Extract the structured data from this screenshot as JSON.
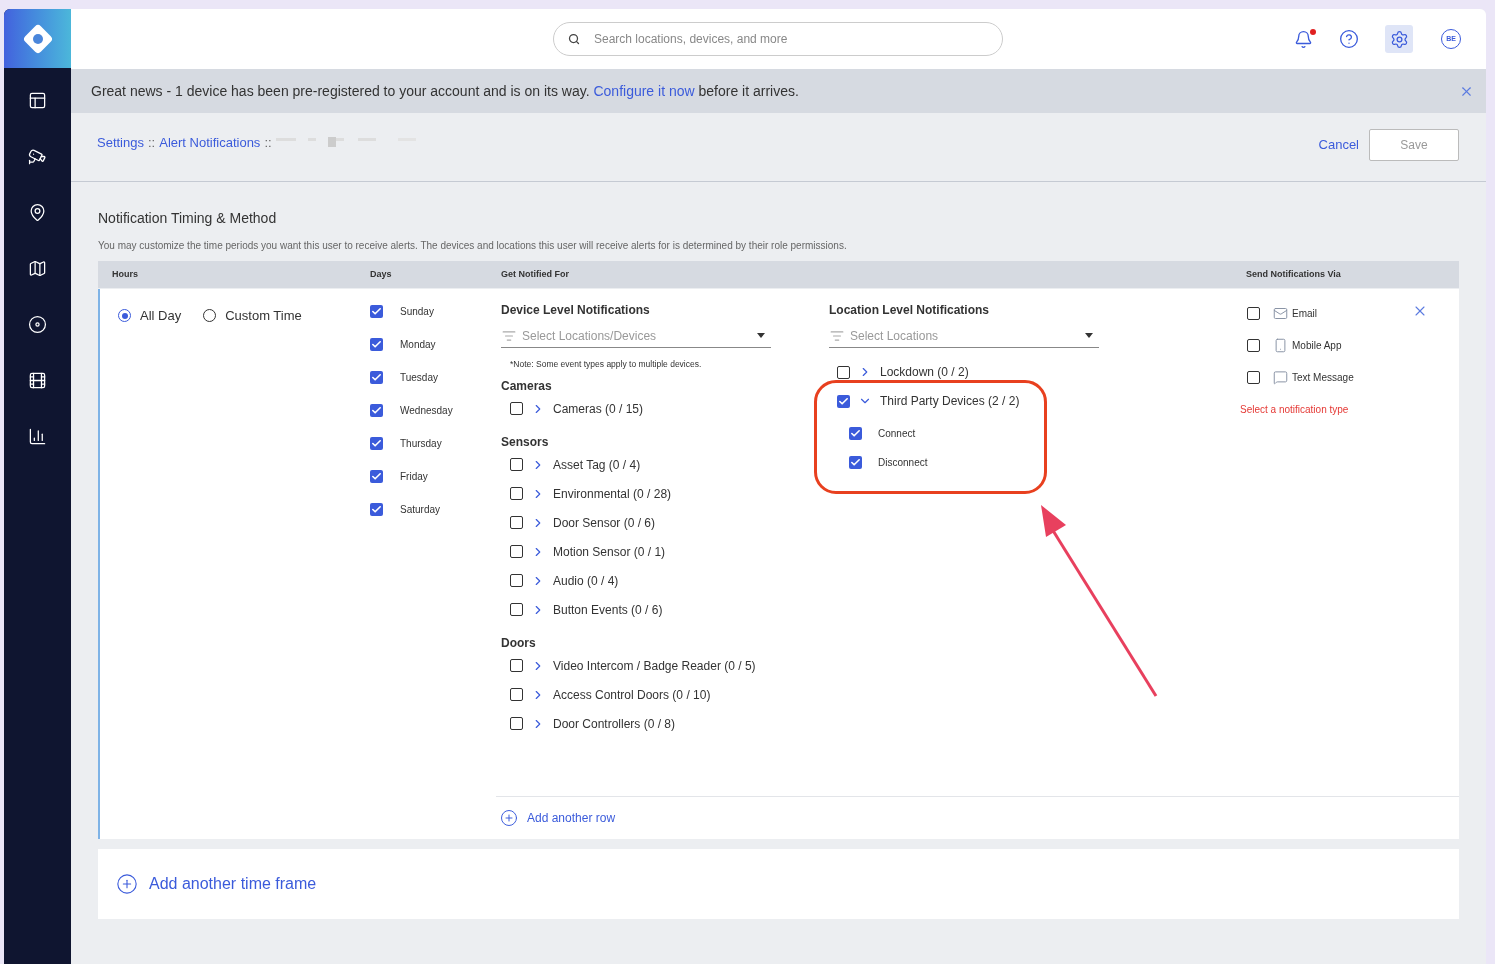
{
  "search": {
    "placeholder": "Search locations, devices, and more"
  },
  "notifications": {
    "unread": true
  },
  "avatar": "BE",
  "banner": {
    "text_before": "Great news - 1 device has been pre-registered to your account and is on its way.",
    "link": "Configure it now",
    "text_after": "before it arrives."
  },
  "breadcrumb": {
    "items": [
      "Settings",
      "Alert Notifications"
    ],
    "separator": "::"
  },
  "actions": {
    "cancel": "Cancel",
    "save": "Save",
    "save_disabled": true
  },
  "section": {
    "title": "Notification Timing & Method",
    "description": "You may customize the time periods you want this user to receive alerts. The devices and locations this user will receive alerts for is determined by their role permissions."
  },
  "columns": [
    "Hours",
    "Days",
    "Get Notified For",
    "Send Notifications Via"
  ],
  "hours": [
    {
      "label": "All Day",
      "selected": true
    },
    {
      "label": "Custom Time",
      "selected": false
    }
  ],
  "days": [
    {
      "label": "Sunday",
      "checked": true
    },
    {
      "label": "Monday",
      "checked": true
    },
    {
      "label": "Tuesday",
      "checked": true
    },
    {
      "label": "Wednesday",
      "checked": true
    },
    {
      "label": "Thursday",
      "checked": true
    },
    {
      "label": "Friday",
      "checked": true
    },
    {
      "label": "Saturday",
      "checked": true
    }
  ],
  "device_level": {
    "title": "Device Level Notifications",
    "placeholder": "Select Locations/Devices",
    "note": "*Note: Some event types apply to multiple devices.",
    "groups": [
      {
        "title": "Cameras",
        "items": [
          {
            "label": "Cameras (0 / 15)",
            "checked": false,
            "expanded": false
          }
        ]
      },
      {
        "title": "Sensors",
        "items": [
          {
            "label": "Asset Tag (0 / 4)",
            "checked": false,
            "expanded": false
          },
          {
            "label": "Environmental (0 / 28)",
            "checked": false,
            "expanded": false
          },
          {
            "label": "Door Sensor (0 / 6)",
            "checked": false,
            "expanded": false
          },
          {
            "label": "Motion Sensor (0 / 1)",
            "checked": false,
            "expanded": false
          },
          {
            "label": "Audio (0 / 4)",
            "checked": false,
            "expanded": false
          },
          {
            "label": "Button Events (0 / 6)",
            "checked": false,
            "expanded": false
          }
        ]
      },
      {
        "title": "Doors",
        "items": [
          {
            "label": "Video Intercom / Badge Reader (0 / 5)",
            "checked": false,
            "expanded": false
          },
          {
            "label": "Access Control Doors (0 / 10)",
            "checked": false,
            "expanded": false
          },
          {
            "label": "Door Controllers (0 / 8)",
            "checked": false,
            "expanded": false
          }
        ]
      }
    ]
  },
  "location_level": {
    "title": "Location Level Notifications",
    "placeholder": "Select Locations",
    "items": [
      {
        "label": "Lockdown (0 / 2)",
        "checked": false,
        "expanded": false
      },
      {
        "label": "Third Party Devices (2 / 2)",
        "checked": true,
        "expanded": true,
        "children": [
          {
            "label": "Connect",
            "checked": true
          },
          {
            "label": "Disconnect",
            "checked": true
          }
        ]
      }
    ]
  },
  "send_via": {
    "options": [
      {
        "kind": "email",
        "label": "Email",
        "checked": false
      },
      {
        "kind": "mobile",
        "label": "Mobile App",
        "checked": false
      },
      {
        "kind": "sms",
        "label": "Text Message",
        "checked": false
      }
    ],
    "error": "Select a notification type"
  },
  "add_row": "Add another row",
  "add_time_frame": "Add another time frame"
}
